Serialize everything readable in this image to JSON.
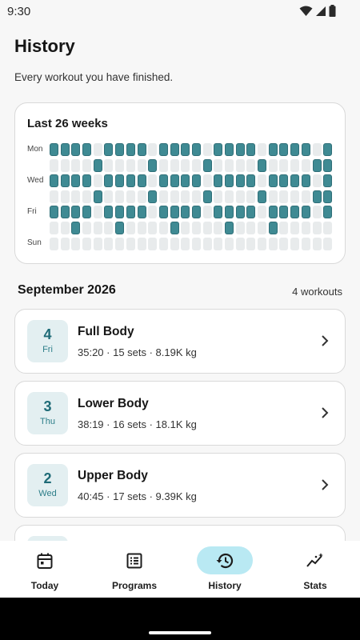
{
  "status": {
    "time": "9:30"
  },
  "header": {
    "title": "History",
    "subtitle": "Every workout you have finished."
  },
  "heatmap": {
    "title": "Last 26 weeks",
    "row_labels": [
      "Mon",
      "",
      "Wed",
      "",
      "Fri",
      "",
      "Sun"
    ],
    "colors": {
      "active": "#3f8a93",
      "inactive": "#e8ebec"
    },
    "rows": [
      [
        1,
        1,
        1,
        1,
        0,
        1,
        1,
        1,
        1,
        0,
        1,
        1,
        1,
        1,
        0,
        1,
        1,
        1,
        1,
        0,
        1,
        1,
        1,
        1,
        0,
        1
      ],
      [
        0,
        0,
        0,
        0,
        1,
        0,
        0,
        0,
        0,
        1,
        0,
        0,
        0,
        0,
        1,
        0,
        0,
        0,
        0,
        1,
        0,
        0,
        0,
        0,
        1,
        1
      ],
      [
        1,
        1,
        1,
        1,
        0,
        1,
        1,
        1,
        1,
        0,
        1,
        1,
        1,
        1,
        0,
        1,
        1,
        1,
        1,
        0,
        1,
        1,
        1,
        1,
        0,
        1
      ],
      [
        0,
        0,
        0,
        0,
        1,
        0,
        0,
        0,
        0,
        1,
        0,
        0,
        0,
        0,
        1,
        0,
        0,
        0,
        0,
        1,
        0,
        0,
        0,
        0,
        1,
        1
      ],
      [
        1,
        1,
        1,
        1,
        0,
        1,
        1,
        1,
        1,
        0,
        1,
        1,
        1,
        1,
        0,
        1,
        1,
        1,
        1,
        0,
        1,
        1,
        1,
        1,
        0,
        1
      ],
      [
        0,
        0,
        1,
        0,
        0,
        0,
        1,
        0,
        0,
        0,
        0,
        1,
        0,
        0,
        0,
        0,
        1,
        0,
        0,
        0,
        1,
        0,
        0,
        0,
        0,
        0
      ],
      [
        0,
        0,
        0,
        0,
        0,
        0,
        0,
        0,
        0,
        0,
        0,
        0,
        0,
        0,
        0,
        0,
        0,
        0,
        0,
        0,
        0,
        0,
        0,
        0,
        0,
        0
      ]
    ]
  },
  "month": {
    "title": "September 2026",
    "count": "4 workouts"
  },
  "workouts": [
    {
      "day": "4",
      "dow": "Fri",
      "name": "Full Body",
      "meta": "35:20 · 15 sets · 8.19K kg"
    },
    {
      "day": "3",
      "dow": "Thu",
      "name": "Lower Body",
      "meta": "38:19 · 16 sets · 18.1K kg"
    },
    {
      "day": "2",
      "dow": "Wed",
      "name": "Upper Body",
      "meta": "40:45 · 17 sets · 9.39K kg"
    },
    {
      "day": "",
      "dow": "",
      "name": "",
      "meta": ""
    }
  ],
  "nav": {
    "items": [
      {
        "label": "Today",
        "icon": "calendar-icon"
      },
      {
        "label": "Programs",
        "icon": "list-icon"
      },
      {
        "label": "History",
        "icon": "history-icon",
        "active": true
      },
      {
        "label": "Stats",
        "icon": "stats-icon"
      }
    ]
  }
}
